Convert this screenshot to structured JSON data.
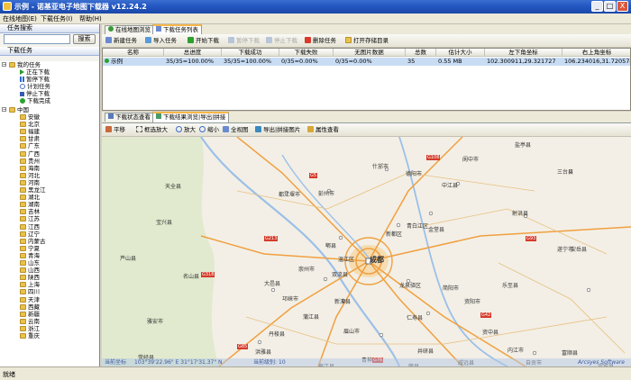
{
  "window": {
    "title": "示例 - 诺基亚电子地图下载器 v12.24.2",
    "buttons": {
      "minimize": "_",
      "maximize": "□",
      "close": "X"
    }
  },
  "menu": [
    "在线地图(E)",
    "下载任务(I)",
    "帮助(H)"
  ],
  "left_panel": {
    "search_header": "任务搜索",
    "search_placeholder": "",
    "search_button": "搜索",
    "task_header": "下载任务",
    "my_tasks": "我的任务",
    "task_items": [
      "正在下载",
      "暂停下载",
      "计划任务",
      "停止下载",
      "下载完成"
    ],
    "region_root": "中国",
    "regions": [
      "安徽",
      "北京",
      "福建",
      "甘肃",
      "广东",
      "广西",
      "贵州",
      "海南",
      "河北",
      "河南",
      "黑龙江",
      "湖北",
      "湖南",
      "吉林",
      "江苏",
      "江西",
      "辽宁",
      "内蒙古",
      "宁夏",
      "青海",
      "山东",
      "山西",
      "陕西",
      "上海",
      "四川",
      "天津",
      "西藏",
      "新疆",
      "云南",
      "浙江",
      "重庆"
    ]
  },
  "top_tabs": [
    "在线地图浏览",
    "下载任务列表"
  ],
  "task_toolbar": [
    "新建任务",
    "导入任务",
    "开始下载",
    "暂停下载",
    "停止下载",
    "删除任务",
    "打开存储目录"
  ],
  "task_table": {
    "columns": [
      "名称",
      "总进度",
      "下载成功",
      "下载失败",
      "无图片数据",
      "总数",
      "估计大小",
      "左下角坐标",
      "右上角坐标"
    ],
    "rows": [
      [
        "示例",
        "35/35=100.00%",
        "35/35=100.00%",
        "0/35=0.00%",
        "0/35=0.00%",
        "35",
        "0.55 MB",
        "102.300911,29.321727",
        "106.234016,31.720574"
      ]
    ]
  },
  "bottom_tabs": [
    "下载状态查看",
    "下载结果浏览|导出|拼接"
  ],
  "map_toolbar": [
    "平移",
    "框选放大",
    "放大",
    "缩小",
    "全视图",
    "导出|拼接图片",
    "属性查看"
  ],
  "map": {
    "labels": [
      "阆中市",
      "什邡市",
      "德阳市",
      "三台县",
      "都江堰市",
      "彭州市",
      "中江县",
      "盐亭县",
      "射洪县",
      "成都",
      "金堂县",
      "双流县",
      "简阳市",
      "龙泉驿区",
      "新都区",
      "青白江区",
      "邛崃市",
      "崇州市",
      "郫县",
      "温江区",
      "蒲江县",
      "新津县",
      "大邑县",
      "眉山市",
      "仁寿县",
      "资阳市",
      "乐至县",
      "遂宁市",
      "安岳县",
      "丹棱县",
      "洪雅县",
      "夹江县",
      "青神县",
      "井研县",
      "资中县",
      "内江市",
      "威远县",
      "荣县",
      "自贡市",
      "富顺县",
      "宜宾县",
      "宝兴县",
      "芦山县",
      "天全县",
      "雅安市",
      "名山县",
      "荥经县"
    ],
    "road_labels": [
      "G5",
      "G93",
      "G42",
      "G76",
      "G85",
      "G213",
      "G318",
      "G108"
    ],
    "coord_label": "当前坐标",
    "coord_value": "103°39'22.96\" E 31°17'31.37\" N",
    "level_label": "当前级别:",
    "level_value": "10",
    "brand": "Arcsyes Software"
  },
  "status": "就绪"
}
